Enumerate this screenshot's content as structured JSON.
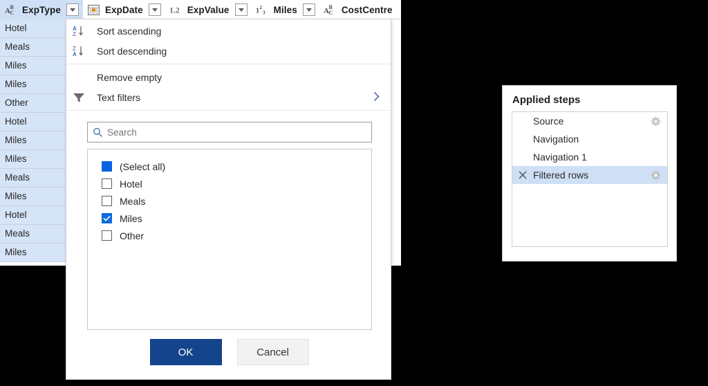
{
  "grid": {
    "columns": [
      {
        "name": "ExpType",
        "icon": "text-type-icon",
        "icon_label": "ABC",
        "active": true,
        "has_dropdown": true
      },
      {
        "name": "ExpDate",
        "icon": "calendar-icon",
        "icon_label": "",
        "active": false,
        "has_dropdown": true
      },
      {
        "name": "ExpValue",
        "icon": "decimal-type-icon",
        "icon_label": "1.2",
        "active": false,
        "has_dropdown": true
      },
      {
        "name": "Miles",
        "icon": "integer-type-icon",
        "icon_label": "123",
        "active": false,
        "has_dropdown": true
      },
      {
        "name": "CostCentre",
        "icon": "text-type-icon",
        "icon_label": "ABC",
        "active": false,
        "has_dropdown": false
      }
    ],
    "rows": [
      "Hotel",
      "Meals",
      "Miles",
      "Miles",
      "Other",
      "Hotel",
      "Miles",
      "Miles",
      "Meals",
      "Miles",
      "Hotel",
      "Meals",
      "Miles"
    ]
  },
  "filter_menu": {
    "sort_ascending": "Sort ascending",
    "sort_descending": "Sort descending",
    "remove_empty": "Remove empty",
    "text_filters": "Text filters",
    "search": {
      "placeholder": "Search",
      "value": ""
    },
    "items": [
      {
        "label": "(Select all)",
        "state": "indeterminate"
      },
      {
        "label": "Hotel",
        "state": "unchecked"
      },
      {
        "label": "Meals",
        "state": "unchecked"
      },
      {
        "label": "Miles",
        "state": "checked"
      },
      {
        "label": "Other",
        "state": "unchecked"
      }
    ],
    "ok_label": "OK",
    "cancel_label": "Cancel"
  },
  "applied_steps": {
    "title": "Applied steps",
    "steps": [
      {
        "label": "Source",
        "selected": false,
        "has_gear": true,
        "has_delete": false
      },
      {
        "label": "Navigation",
        "selected": false,
        "has_gear": false,
        "has_delete": false
      },
      {
        "label": "Navigation 1",
        "selected": false,
        "has_gear": false,
        "has_delete": false
      },
      {
        "label": "Filtered rows",
        "selected": true,
        "has_gear": true,
        "has_delete": true
      }
    ]
  },
  "colors": {
    "accent_blue": "#0a62e0",
    "selection_blue": "#cfe0f6",
    "cell_blue": "#d6e4f7",
    "ok_button": "#14448c",
    "calendar_orange": "#e8840c"
  }
}
